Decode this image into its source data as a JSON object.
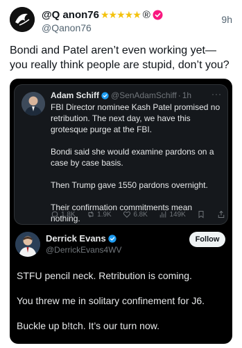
{
  "post": {
    "author_name": "@Q anon76",
    "author_stars": "★★★★★",
    "author_reg": "®",
    "author_handle": "@Qanon76",
    "time": "9h",
    "text": "Bondi and Patel aren’t even working yet—you really think people are stupid, don’t you?"
  },
  "quoted": {
    "author_name": "Adam Schiff",
    "author_handle": "@SenAdamSchiff",
    "separator": "·",
    "time": "1h",
    "more": "···",
    "paragraphs": [
      "FBI Director nominee Kash Patel promised no retribution. The next day, we have this grotesque purge at the FBI.",
      "Bondi said she would examine pardons on a case by case basis.",
      "Then Trump gave 1550 pardons overnight.",
      "Their confirmation commitments mean nothing."
    ],
    "stats": {
      "replies": "1.8K",
      "reposts": "1.9K",
      "likes": "6.8K",
      "views": "149K"
    }
  },
  "reply": {
    "author_name": "Derrick Evans",
    "author_handle": "@DerrickEvans4WV",
    "follow_label": "Follow",
    "paragraphs": [
      "STFU pencil neck. Retribution is coming.",
      "You threw me in solitary confinement for J6.",
      "Buckle up b!tch. It’s our turn now."
    ]
  },
  "colors": {
    "verified_blue": "#1d9bf0",
    "badge_pink": "#f91880",
    "star_gold": "#f4c20d"
  }
}
